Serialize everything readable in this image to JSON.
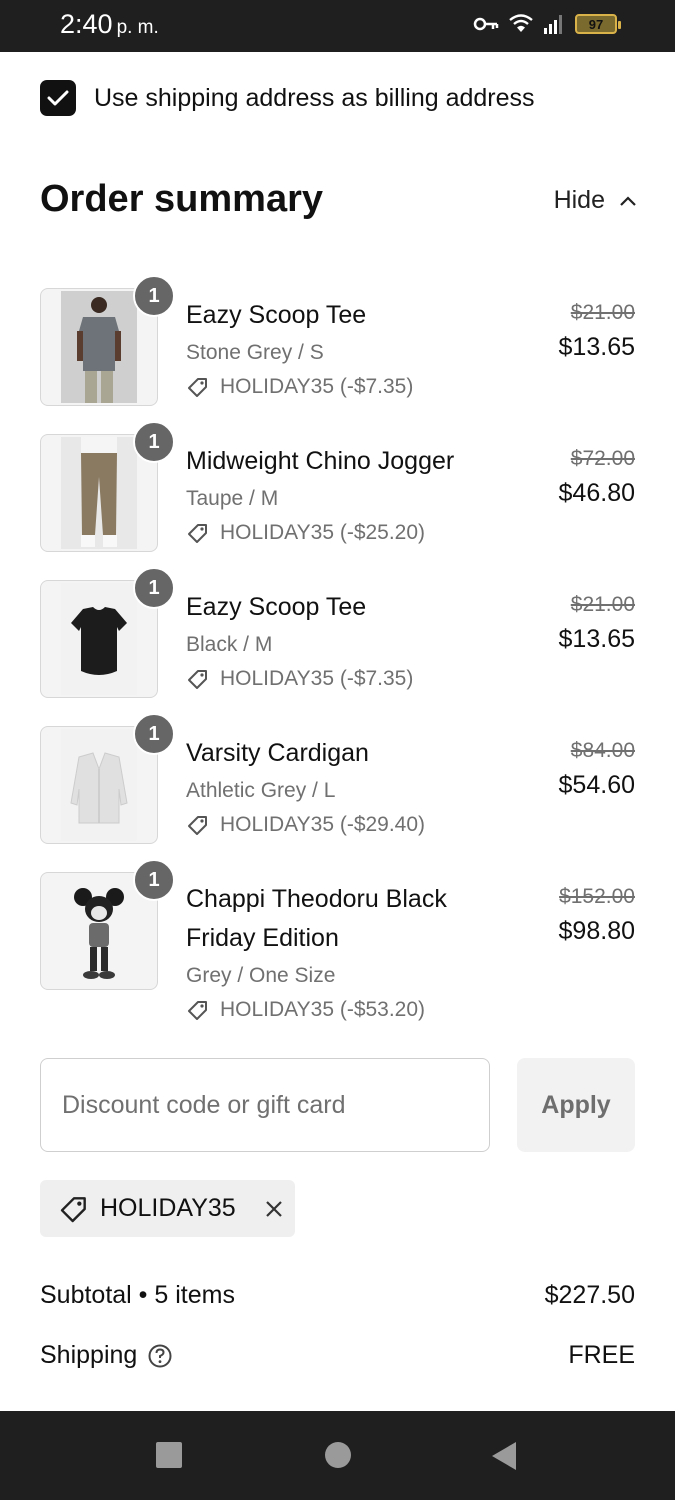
{
  "status_bar": {
    "time": "2:40",
    "ampm": "p. m.",
    "battery": "97"
  },
  "billing": {
    "checked": true,
    "label": "Use shipping address as billing address"
  },
  "summary": {
    "title": "Order summary",
    "toggle_label": "Hide"
  },
  "items": [
    {
      "quantity": "1",
      "name": "Eazy Scoop Tee",
      "variant": "Stone Grey / S",
      "discount": "HOLIDAY35 (-$7.35)",
      "original_price": "$21.00",
      "price": "$13.65"
    },
    {
      "quantity": "1",
      "name": "Midweight Chino Jogger",
      "variant": "Taupe / M",
      "discount": "HOLIDAY35 (-$25.20)",
      "original_price": "$72.00",
      "price": "$46.80"
    },
    {
      "quantity": "1",
      "name": "Eazy Scoop Tee",
      "variant": "Black / M",
      "discount": "HOLIDAY35 (-$7.35)",
      "original_price": "$21.00",
      "price": "$13.65"
    },
    {
      "quantity": "1",
      "name": "Varsity Cardigan",
      "variant": "Athletic Grey / L",
      "discount": "HOLIDAY35 (-$29.40)",
      "original_price": "$84.00",
      "price": "$54.60"
    },
    {
      "quantity": "1",
      "name": "Chappi Theodoru Black Friday Edition",
      "variant": "Grey / One Size",
      "discount": "HOLIDAY35 (-$53.20)",
      "original_price": "$152.00",
      "price": "$98.80"
    }
  ],
  "discount_form": {
    "placeholder": "Discount code or gift card",
    "apply_label": "Apply",
    "applied_code": "HOLIDAY35"
  },
  "totals": {
    "subtotal_label": "Subtotal • 5 items",
    "subtotal_value": "$227.50",
    "shipping_label": "Shipping",
    "shipping_value": "FREE"
  },
  "colors": {
    "text": "#111111",
    "muted": "#707070",
    "bars": "#1f1f1f",
    "badge": "#666666"
  }
}
